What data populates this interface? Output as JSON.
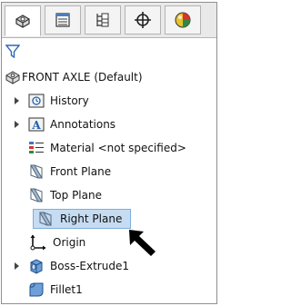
{
  "tabs": [
    {
      "name": "featuremanager",
      "icon": "assembly-feature-icon"
    },
    {
      "name": "propertymanager",
      "icon": "property-list-icon"
    },
    {
      "name": "configurationmanager",
      "icon": "configuration-icon"
    },
    {
      "name": "dimxpert",
      "icon": "crosshair-icon"
    },
    {
      "name": "display",
      "icon": "appearance-ball-icon"
    }
  ],
  "filter": {
    "icon": "filter-icon"
  },
  "tree": {
    "root": {
      "label": "FRONT AXLE  (Default)",
      "icon": "part-icon"
    },
    "items": [
      {
        "label": "History",
        "icon": "history-icon",
        "expandable": true
      },
      {
        "label": "Annotations",
        "icon": "annotations-icon",
        "expandable": true
      },
      {
        "label": "Material <not specified>",
        "icon": "material-icon",
        "expandable": false
      },
      {
        "label": "Front Plane",
        "icon": "plane-icon",
        "expandable": false
      },
      {
        "label": "Top Plane",
        "icon": "plane-icon",
        "expandable": false
      },
      {
        "label": "Right Plane",
        "icon": "plane-icon",
        "expandable": false,
        "selected": true
      },
      {
        "label": "Origin",
        "icon": "origin-icon",
        "expandable": false
      },
      {
        "label": "Boss-Extrude1",
        "icon": "extrude-icon",
        "expandable": true
      },
      {
        "label": "Fillet1",
        "icon": "fillet-icon",
        "expandable": false
      }
    ]
  },
  "colors": {
    "selection": "#c5dcf2",
    "selection_border": "#7eaedb",
    "accent_red": "#c0392b",
    "accent_blue": "#1f5fa8"
  }
}
